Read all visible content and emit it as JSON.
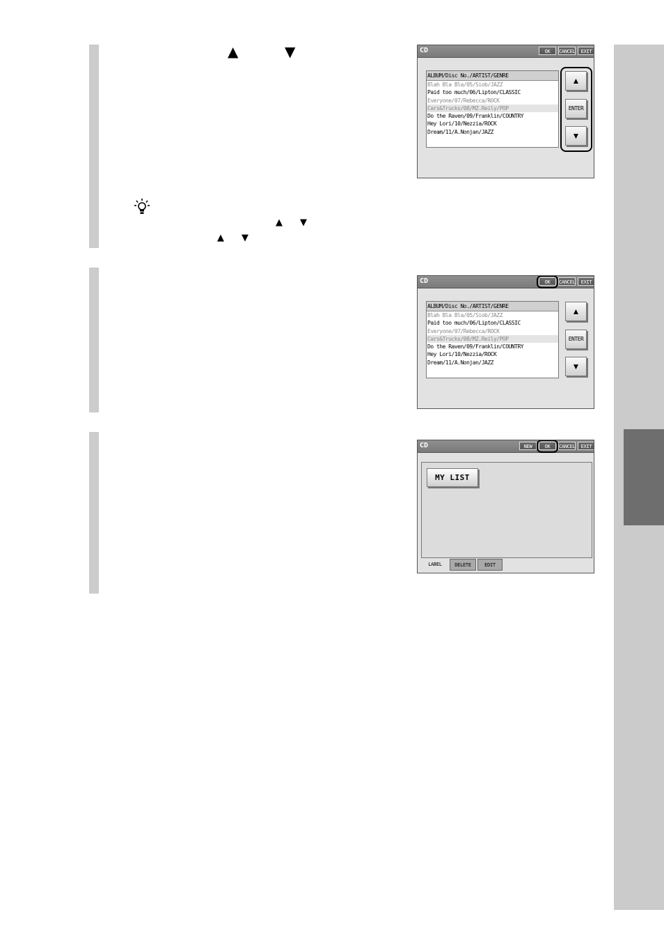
{
  "symbols": {
    "up": "▲",
    "down": "▼"
  },
  "screen1": {
    "title": "CD",
    "buttons": [
      "OK",
      "CANCEL",
      "EXIT"
    ],
    "list_header": "ALBUM/Disc No./ARTIST/GENRE",
    "list_items": [
      "Blah Bla Bla/05/Siob/JAZZ",
      "Paid too much/06/Lipton/CLASSIC",
      "Everyone/07/Rebecca/ROCK",
      "Cars&Trucks/08/MZ.Reily/POP",
      "Do the Raven/09/Franklin/COUNTRY",
      "Hey Lori/10/Nezzia/ROCK",
      "Dream/11/A.Nonjan/JAZZ"
    ],
    "side_buttons": [
      "▲",
      "ENTER",
      "▼"
    ]
  },
  "screen2": {
    "title": "CD",
    "buttons": [
      "OK",
      "CANCEL",
      "EXIT"
    ],
    "list_header": "ALBUM/Disc No./ARTIST/GENRE",
    "list_items": [
      "Blah Bla Bla/05/Siob/JAZZ",
      "Paid too much/06/Lipton/CLASSIC",
      "Everyone/07/Rebecca/ROCK",
      "Cars&Trucks/08/MZ.Reily/POP",
      "Do the Raven/09/Franklin/COUNTRY",
      "Hey Lori/10/Nezzia/ROCK",
      "Dream/11/A.Nonjan/JAZZ"
    ],
    "side_buttons": [
      "▲",
      "ENTER",
      "▼"
    ]
  },
  "screen3": {
    "title": "CD",
    "buttons": [
      "NEW",
      "OK",
      "CANCEL",
      "EXIT"
    ],
    "mylist_label": "MY LIST",
    "tabs": [
      "LABEL",
      "DELETE",
      "EDIT"
    ]
  }
}
